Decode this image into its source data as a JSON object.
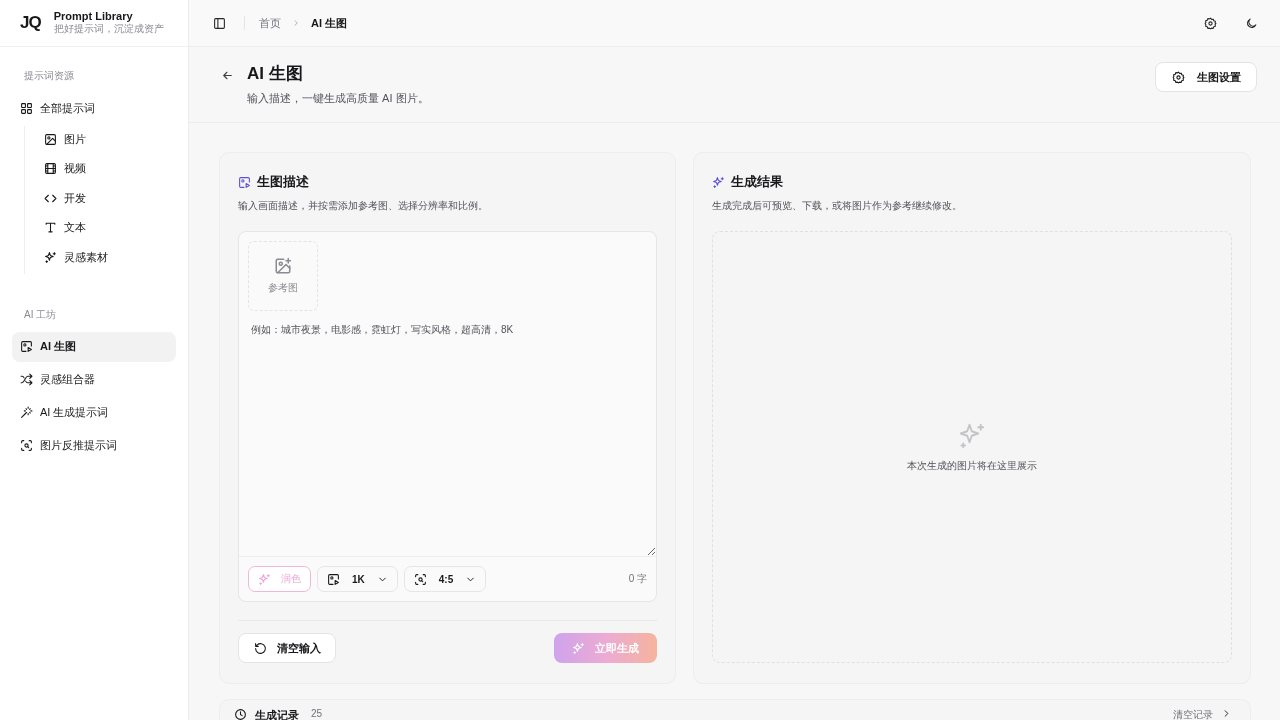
{
  "brand": {
    "logo": "JQ",
    "name": "Prompt Library",
    "tagline": "把好提示词，沉淀成资产"
  },
  "sidebar": {
    "sections": [
      {
        "title": "提示词资源",
        "items": [
          {
            "label": "全部提示词",
            "selected": false,
            "children": [
              {
                "label": "图片",
                "selected": false
              },
              {
                "label": "视频",
                "selected": false
              },
              {
                "label": "开发",
                "selected": false
              },
              {
                "label": "文本",
                "selected": false
              },
              {
                "label": "灵感素材",
                "selected": false
              }
            ]
          }
        ]
      },
      {
        "title": "AI 工坊",
        "items": [
          {
            "label": "AI 生图",
            "selected": true
          },
          {
            "label": "灵感组合器",
            "selected": false
          },
          {
            "label": "AI 生成提示词",
            "selected": false
          },
          {
            "label": "图片反推提示词",
            "selected": false
          }
        ]
      }
    ]
  },
  "breadcrumb": [
    {
      "label": "首页",
      "current": false
    },
    {
      "label": "AI 生图",
      "current": true
    }
  ],
  "page": {
    "title": "AI 生图",
    "subtitle": "输入描述，一键生成高质量 AI 图片。",
    "settings_button": "生图设置"
  },
  "prompt_panel": {
    "title": "生图描述",
    "subtitle": "输入画面描述，并按需添加参考图、选择分辨率和比例。",
    "reference_label": "参考图",
    "placeholder": "例如：城市夜景，电影感，霓虹灯，写实风格，超高清，8K",
    "polish_button": {
      "label": "润色",
      "disabled": true
    },
    "resolution": "1K",
    "ratio": "4:5",
    "char_count": "0 字",
    "clear_button": "清空输入",
    "generate_button": {
      "label": "立即生成",
      "disabled": true
    }
  },
  "result_panel": {
    "title": "生成结果",
    "subtitle": "生成完成后可预览、下载，或将图片作为参考继续修改。",
    "empty_text": "本次生成的图片将在这里展示"
  },
  "history": {
    "title": "生成记录",
    "count": "25",
    "clear_link": "清空记录"
  }
}
